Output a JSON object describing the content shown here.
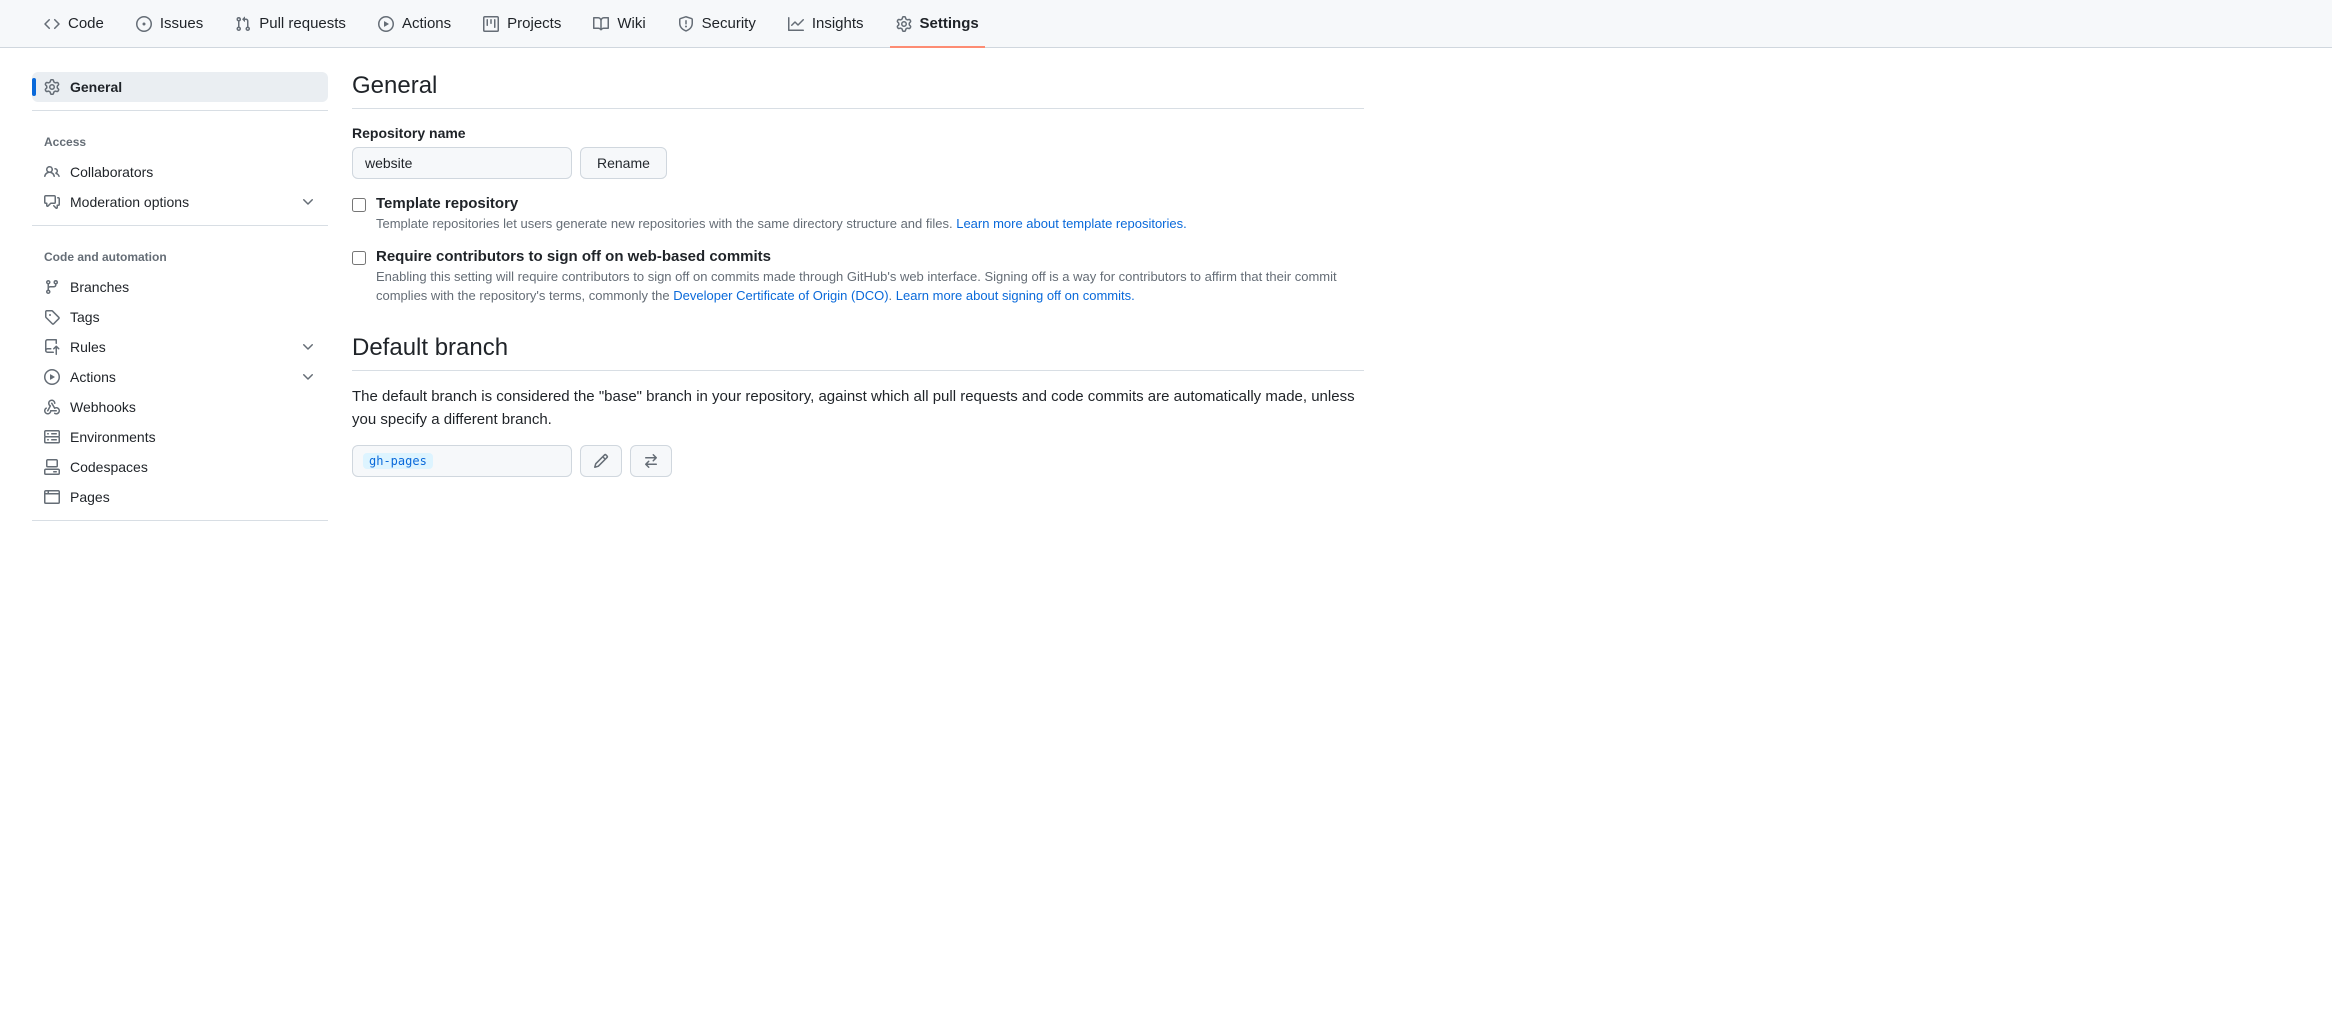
{
  "topnav": {
    "items": [
      {
        "label": "Code"
      },
      {
        "label": "Issues"
      },
      {
        "label": "Pull requests"
      },
      {
        "label": "Actions"
      },
      {
        "label": "Projects"
      },
      {
        "label": "Wiki"
      },
      {
        "label": "Security"
      },
      {
        "label": "Insights"
      },
      {
        "label": "Settings"
      }
    ]
  },
  "sidebar": {
    "general": "General",
    "sections": {
      "access": {
        "title": "Access",
        "items": [
          {
            "label": "Collaborators"
          },
          {
            "label": "Moderation options"
          }
        ]
      },
      "code_automation": {
        "title": "Code and automation",
        "items": [
          {
            "label": "Branches"
          },
          {
            "label": "Tags"
          },
          {
            "label": "Rules"
          },
          {
            "label": "Actions"
          },
          {
            "label": "Webhooks"
          },
          {
            "label": "Environments"
          },
          {
            "label": "Codespaces"
          },
          {
            "label": "Pages"
          }
        ]
      }
    }
  },
  "main": {
    "heading": "General",
    "repo_name": {
      "label": "Repository name",
      "value": "website",
      "rename_button": "Rename"
    },
    "template_checkbox": {
      "title": "Template repository",
      "desc": "Template repositories let users generate new repositories with the same directory structure and files. ",
      "link": "Learn more about template repositories."
    },
    "signoff_checkbox": {
      "title": "Require contributors to sign off on web-based commits",
      "desc_a": "Enabling this setting will require contributors to sign off on commits made through GitHub's web interface. Signing off is a way for contributors to affirm that their commit complies with the repository's terms, commonly the ",
      "link_a": "Developer Certificate of Origin (DCO)",
      "desc_b": ". ",
      "link_b": "Learn more about signing off on commits."
    },
    "default_branch": {
      "heading": "Default branch",
      "desc": "The default branch is considered the \"base\" branch in your repository, against which all pull requests and code commits are automatically made, unless you specify a different branch.",
      "branch": "gh-pages"
    }
  }
}
